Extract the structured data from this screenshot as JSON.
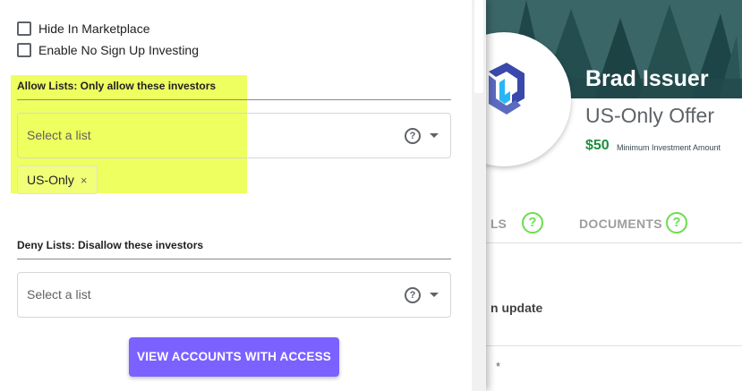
{
  "drawer": {
    "checkboxes": [
      {
        "label": "Hide In Marketplace",
        "checked": false
      },
      {
        "label": "Enable No Sign Up Investing",
        "checked": false
      }
    ],
    "allow_lists": {
      "label": "Allow Lists: Only allow these investors",
      "placeholder": "Select a list",
      "chips": [
        {
          "label": "US-Only",
          "close_icon": "×"
        }
      ]
    },
    "deny_lists": {
      "label": "Deny Lists: Disallow these investors",
      "placeholder": "Select a list"
    },
    "help_icon": "?",
    "view_accounts_button": "VIEW ACCOUNTS WITH ACCESS",
    "highlight_color": "#ecff4f",
    "button_color": "#7b61ff"
  },
  "offer_page": {
    "issuer_name": "Brad Issuer",
    "offer_name": "US-Only Offer",
    "minimum_amount": "$50",
    "minimum_label": "Minimum Investment Amount",
    "tabs": [
      {
        "label": "LS",
        "help_icon": "?"
      },
      {
        "label": "DOCUMENTS",
        "help_icon": "?"
      }
    ],
    "row_text": "n update",
    "row_star": "*",
    "accent_green": "#6ddc4f",
    "amount_green": "#1e8e3e"
  }
}
